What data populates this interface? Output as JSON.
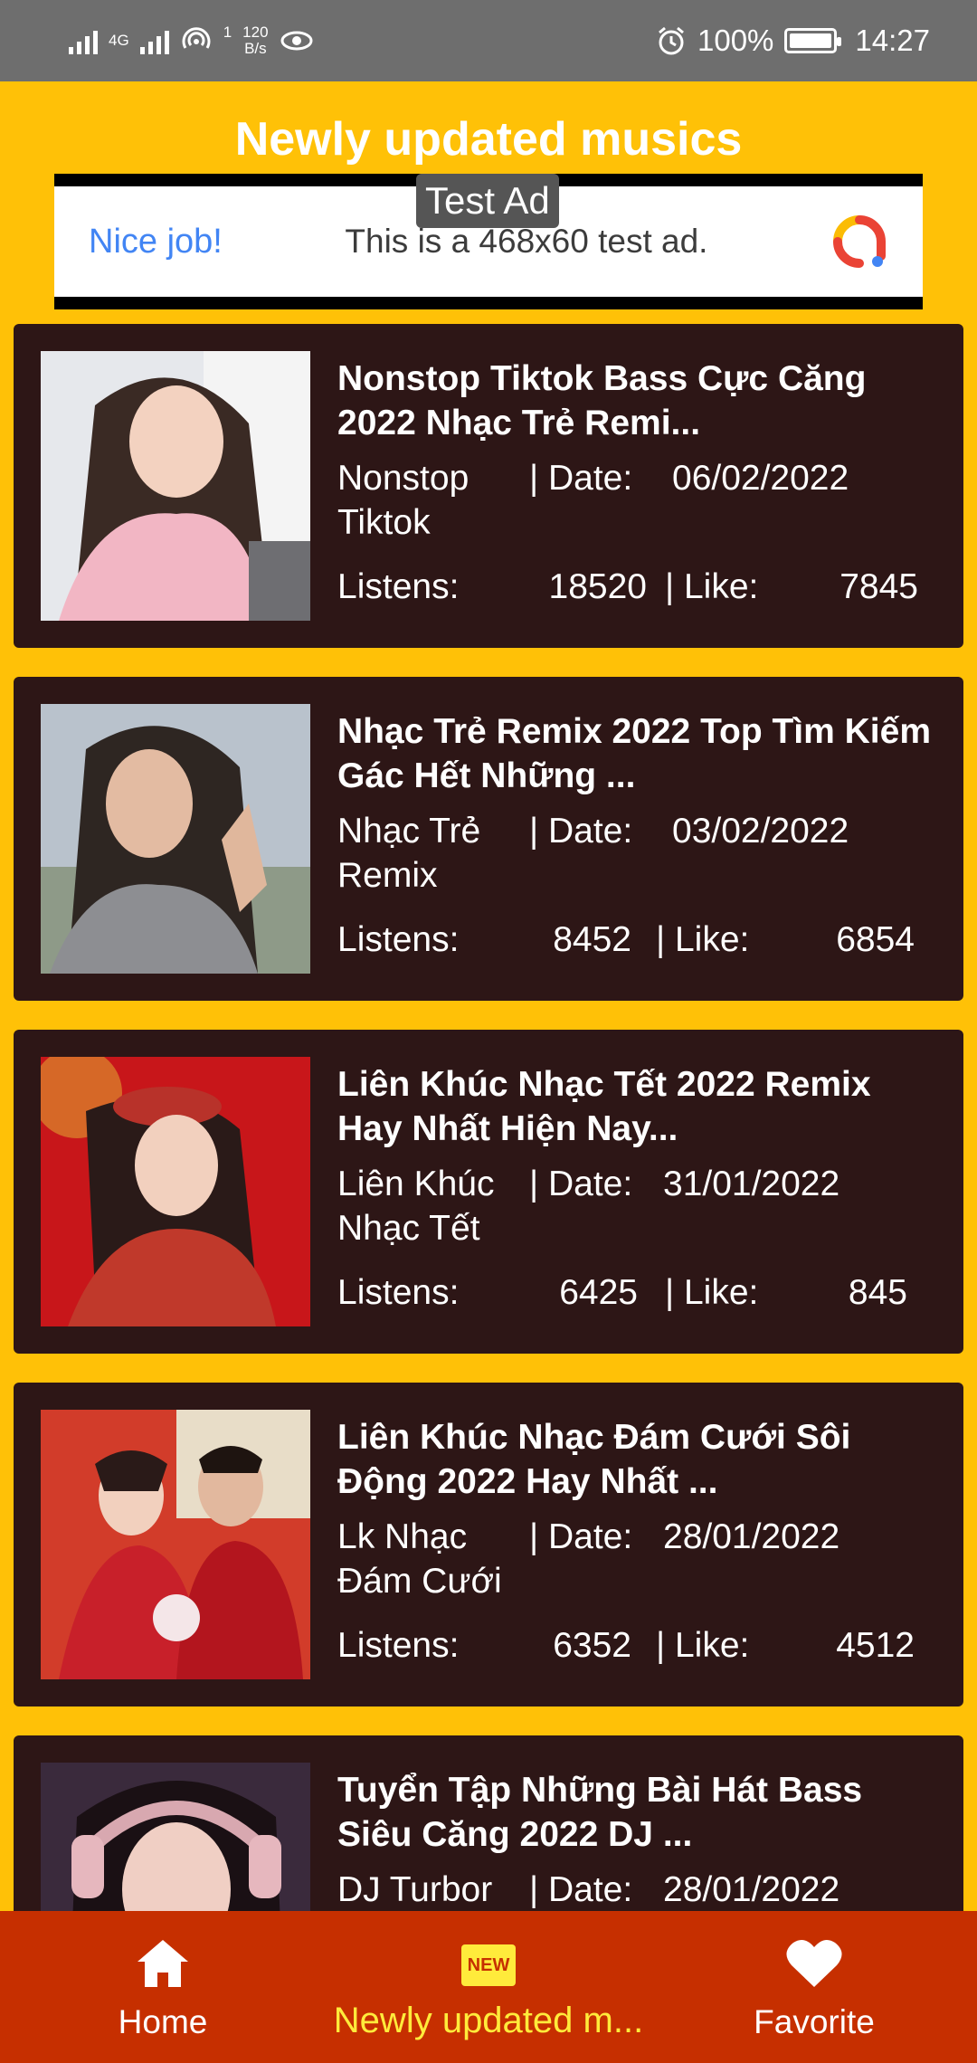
{
  "status_bar": {
    "network": "4G",
    "hotspot_count": "1",
    "speed_value": "120",
    "speed_unit": "B/s",
    "battery": "100%",
    "time": "14:27"
  },
  "header": {
    "title": "Newly updated musics"
  },
  "ad": {
    "label": "Test Ad",
    "cta": "Nice job!",
    "text": "This is a 468x60 test ad."
  },
  "list_labels": {
    "date": "| Date:",
    "listens": "Listens:",
    "like": "| Like:"
  },
  "songs": [
    {
      "title": "Nonstop Tiktok Bass Cực Căng 2022 Nhạc Trẻ Remi...",
      "artist": "Nonstop Tiktok",
      "date": "06/02/2022",
      "listens": "18520",
      "likes": "7845"
    },
    {
      "title": "Nhạc Trẻ Remix 2022 Top Tìm Kiếm Gác Hết Những ...",
      "artist": "Nhạc Trẻ Remix",
      "date": "03/02/2022",
      "listens": "8452",
      "likes": "6854"
    },
    {
      "title": "Liên Khúc Nhạc Tết 2022 Remix Hay Nhất Hiện Nay...",
      "artist": "Liên Khúc Nhạc Tết",
      "date": "31/01/2022",
      "listens": "6425",
      "likes": "845"
    },
    {
      "title": "Liên Khúc Nhạc Đám Cưới Sôi Động 2022 Hay Nhất ...",
      "artist": "Lk Nhạc Đám Cưới",
      "date": "28/01/2022",
      "listens": "6352",
      "likes": "4512"
    },
    {
      "title": "Tuyển Tập Những Bài Hát Bass Siêu Căng 2022 DJ ...",
      "artist": "DJ Turbor",
      "date": "28/01/2022",
      "listens": "",
      "likes": ""
    }
  ],
  "bottom_nav": {
    "home": {
      "label": "Home",
      "icon": "home-icon"
    },
    "newly": {
      "label": "Newly updated m...",
      "icon": "new-badge-icon",
      "badge": "NEW"
    },
    "favorite": {
      "label": "Favorite",
      "icon": "heart-icon"
    }
  },
  "colors": {
    "background": "#FFC107",
    "card": "#2D1616",
    "bottom_nav": "#C62F00",
    "active_nav": "#FFEB3B"
  }
}
